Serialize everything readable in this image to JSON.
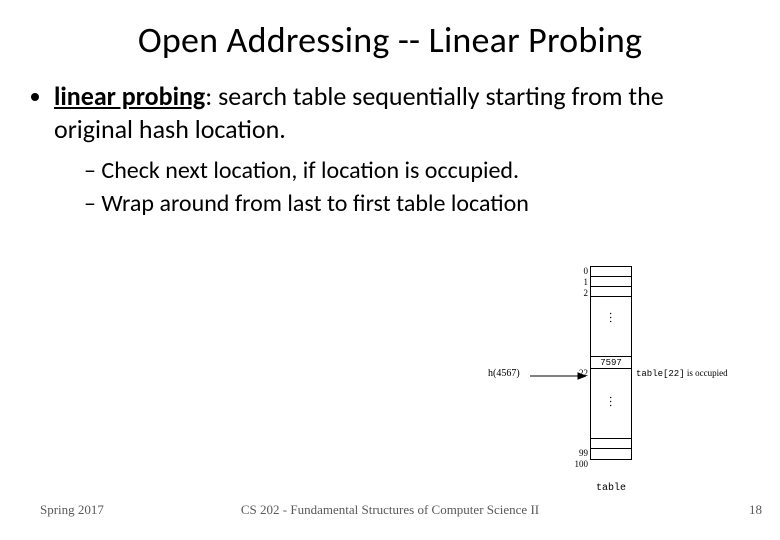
{
  "slide": {
    "title": "Open Addressing -- Linear Probing",
    "bullet_term": "linear probing",
    "bullet_rest": ": search table sequentially starting from the original hash location.",
    "sub1": "Check next location, if location is occupied.",
    "sub2": "Wrap around from last to first table location"
  },
  "diagram": {
    "idx0": "0",
    "idx1": "1",
    "idx2": "2",
    "idx22": "22",
    "idx99": "99",
    "idx100": "100",
    "hash_label": "h(4567)",
    "cell_value": "7597",
    "occupied_cell": "table[22]",
    "occupied_rest": " is occupied",
    "table_label": "table"
  },
  "footer": {
    "left": "Spring 2017",
    "mid": "CS 202 - Fundamental Structures of Computer Science II",
    "right": "18"
  }
}
